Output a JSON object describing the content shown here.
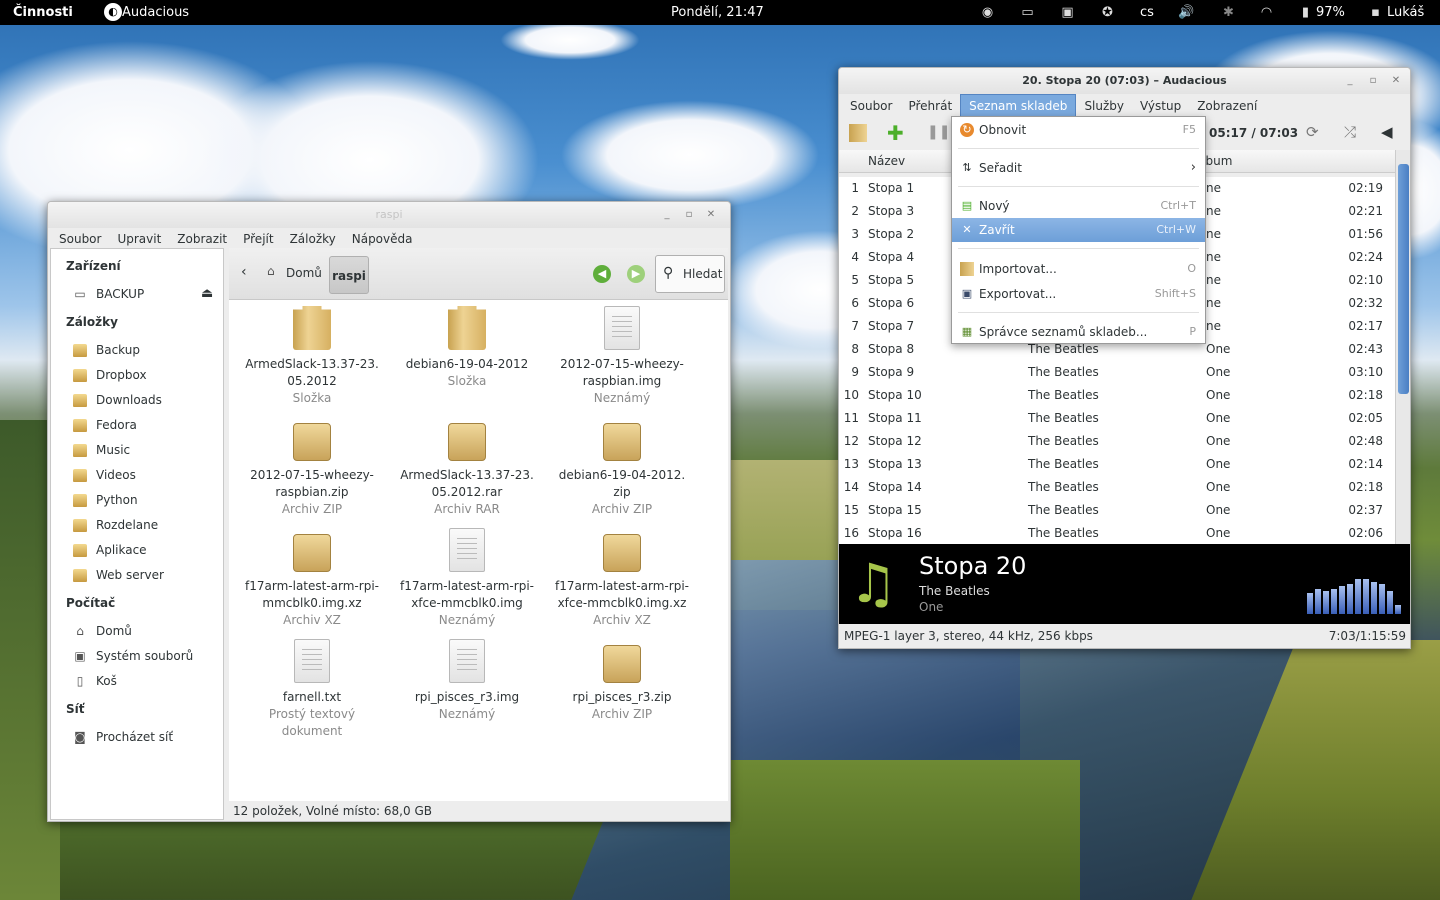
{
  "topbar": {
    "activities": "Činnosti",
    "app_name": "Audacious",
    "clock": "Pondělí, 21:47",
    "lang": "cs",
    "battery": "97%",
    "user": "Lukáš",
    "icons": [
      "disc-icon",
      "folder-icon",
      "display-icon",
      "accessibility-icon",
      "volume-icon",
      "bluetooth-icon",
      "wifi-icon",
      "battery-icon",
      "chat-icon"
    ]
  },
  "nautilus": {
    "title": "raspi",
    "menu": [
      "Soubor",
      "Upravit",
      "Zobrazit",
      "Přejít",
      "Záložky",
      "Nápověda"
    ],
    "sidebar": {
      "devices_header": "Zařízení",
      "devices": [
        "BACKUP"
      ],
      "bookmarks_header": "Záložky",
      "bookmarks": [
        "Backup",
        "Dropbox",
        "Downloads",
        "Fedora",
        "Music",
        "Videos",
        "Python",
        "Rozdelane",
        "Aplikace",
        "Web server"
      ],
      "computer_header": "Počítač",
      "computer": [
        "Domů",
        "Systém souborů",
        "Koš"
      ],
      "network_header": "Síť",
      "network": [
        "Procházet síť"
      ]
    },
    "path": {
      "home": "Domů",
      "current": "raspi"
    },
    "search_label": "Hledat",
    "files": [
      {
        "name": [
          "ArmedSlack-13.37-23.",
          "05.2012"
        ],
        "type": "Složka",
        "icon": "folder"
      },
      {
        "name": [
          "debian6-19-04-2012"
        ],
        "type": "Složka",
        "icon": "folder"
      },
      {
        "name": [
          "2012-07-15-wheezy-",
          "raspbian.img"
        ],
        "type": "Neznámý",
        "icon": "doc"
      },
      {
        "name": [
          "2012-07-15-wheezy-",
          "raspbian.zip"
        ],
        "type": "Archiv ZIP",
        "icon": "box"
      },
      {
        "name": [
          "ArmedSlack-13.37-23.",
          "05.2012.rar"
        ],
        "type": "Archiv RAR",
        "icon": "box"
      },
      {
        "name": [
          "debian6-19-04-2012.",
          "zip"
        ],
        "type": "Archiv ZIP",
        "icon": "box"
      },
      {
        "name": [
          "f17arm-latest-arm-rpi-",
          "mmcblk0.img.xz"
        ],
        "type": "Archiv XZ",
        "icon": "box"
      },
      {
        "name": [
          "f17arm-latest-arm-rpi-",
          "xfce-mmcblk0.img"
        ],
        "type": "Neznámý",
        "icon": "doc"
      },
      {
        "name": [
          "f17arm-latest-arm-rpi-",
          "xfce-mmcblk0.img.xz"
        ],
        "type": "Archiv XZ",
        "icon": "box"
      },
      {
        "name": [
          "farnell.txt"
        ],
        "type": [
          "Prostý textový",
          "dokument"
        ],
        "icon": "doc"
      },
      {
        "name": [
          "rpi_pisces_r3.img"
        ],
        "type": "Neznámý",
        "icon": "doc"
      },
      {
        "name": [
          "rpi_pisces_r3.zip"
        ],
        "type": "Archiv ZIP",
        "icon": "box"
      }
    ],
    "status": "12 položek, Volné místo: 68,0 GB"
  },
  "audacious": {
    "title": "20. Stopa 20 (07:03) – Audacious",
    "menu": [
      "Soubor",
      "Přehrát",
      "Seznam skladeb",
      "Služby",
      "Výstup",
      "Zobrazení"
    ],
    "time": "05:17 / 07:03",
    "columns": {
      "title": "Název",
      "album": "Album"
    },
    "rows": [
      {
        "n": "1",
        "t": "Stopa 1",
        "a": "",
        "al": "ne",
        "d": "02:19"
      },
      {
        "n": "2",
        "t": "Stopa 3",
        "a": "",
        "al": "ne",
        "d": "02:21"
      },
      {
        "n": "3",
        "t": "Stopa 2",
        "a": "",
        "al": "ne",
        "d": "01:56"
      },
      {
        "n": "4",
        "t": "Stopa 4",
        "a": "",
        "al": "ne",
        "d": "02:24"
      },
      {
        "n": "5",
        "t": "Stopa 5",
        "a": "",
        "al": "ne",
        "d": "02:10"
      },
      {
        "n": "6",
        "t": "Stopa 6",
        "a": "",
        "al": "ne",
        "d": "02:32"
      },
      {
        "n": "7",
        "t": "Stopa 7",
        "a": "",
        "al": "ne",
        "d": "02:17"
      },
      {
        "n": "8",
        "t": "Stopa 8",
        "a": "The Beatles",
        "al": "One",
        "d": "02:43"
      },
      {
        "n": "9",
        "t": "Stopa 9",
        "a": "The Beatles",
        "al": "One",
        "d": "03:10"
      },
      {
        "n": "10",
        "t": "Stopa 10",
        "a": "The Beatles",
        "al": "One",
        "d": "02:18"
      },
      {
        "n": "11",
        "t": "Stopa 11",
        "a": "The Beatles",
        "al": "One",
        "d": "02:05"
      },
      {
        "n": "12",
        "t": "Stopa 12",
        "a": "The Beatles",
        "al": "One",
        "d": "02:48"
      },
      {
        "n": "13",
        "t": "Stopa 13",
        "a": "The Beatles",
        "al": "One",
        "d": "02:14"
      },
      {
        "n": "14",
        "t": "Stopa 14",
        "a": "The Beatles",
        "al": "One",
        "d": "02:18"
      },
      {
        "n": "15",
        "t": "Stopa 15",
        "a": "The Beatles",
        "al": "One",
        "d": "02:37"
      },
      {
        "n": "16",
        "t": "Stopa 16",
        "a": "The Beatles",
        "al": "One",
        "d": "02:06"
      }
    ],
    "now_playing": {
      "title": "Stopa 20",
      "artist": "The Beatles",
      "album": "One"
    },
    "status_left": "MPEG-1 layer 3, stereo, 44 kHz, 256 kbps",
    "status_right": "7:03/1:15:59"
  },
  "playlist_menu": {
    "items": [
      {
        "label": "Obnovit",
        "shortcut": "F5",
        "icon": "refresh-icon"
      },
      {
        "label": "Seřadit",
        "shortcut": "›",
        "icon": "sort-icon"
      },
      {
        "label": "Nový",
        "shortcut": "Ctrl+T",
        "icon": "new-icon"
      },
      {
        "label": "Zavřít",
        "shortcut": "Ctrl+W",
        "icon": "close-icon"
      },
      {
        "label": "Importovat...",
        "shortcut": "O",
        "icon": "import-icon"
      },
      {
        "label": "Exportovat...",
        "shortcut": "Shift+S",
        "icon": "save-icon"
      },
      {
        "label": "Správce seznamů skladeb...",
        "shortcut": "P",
        "icon": "playlist-manager-icon"
      }
    ]
  },
  "colors": {
    "accent": "#4a90d9",
    "menu_highlight": "#7aa9de"
  }
}
